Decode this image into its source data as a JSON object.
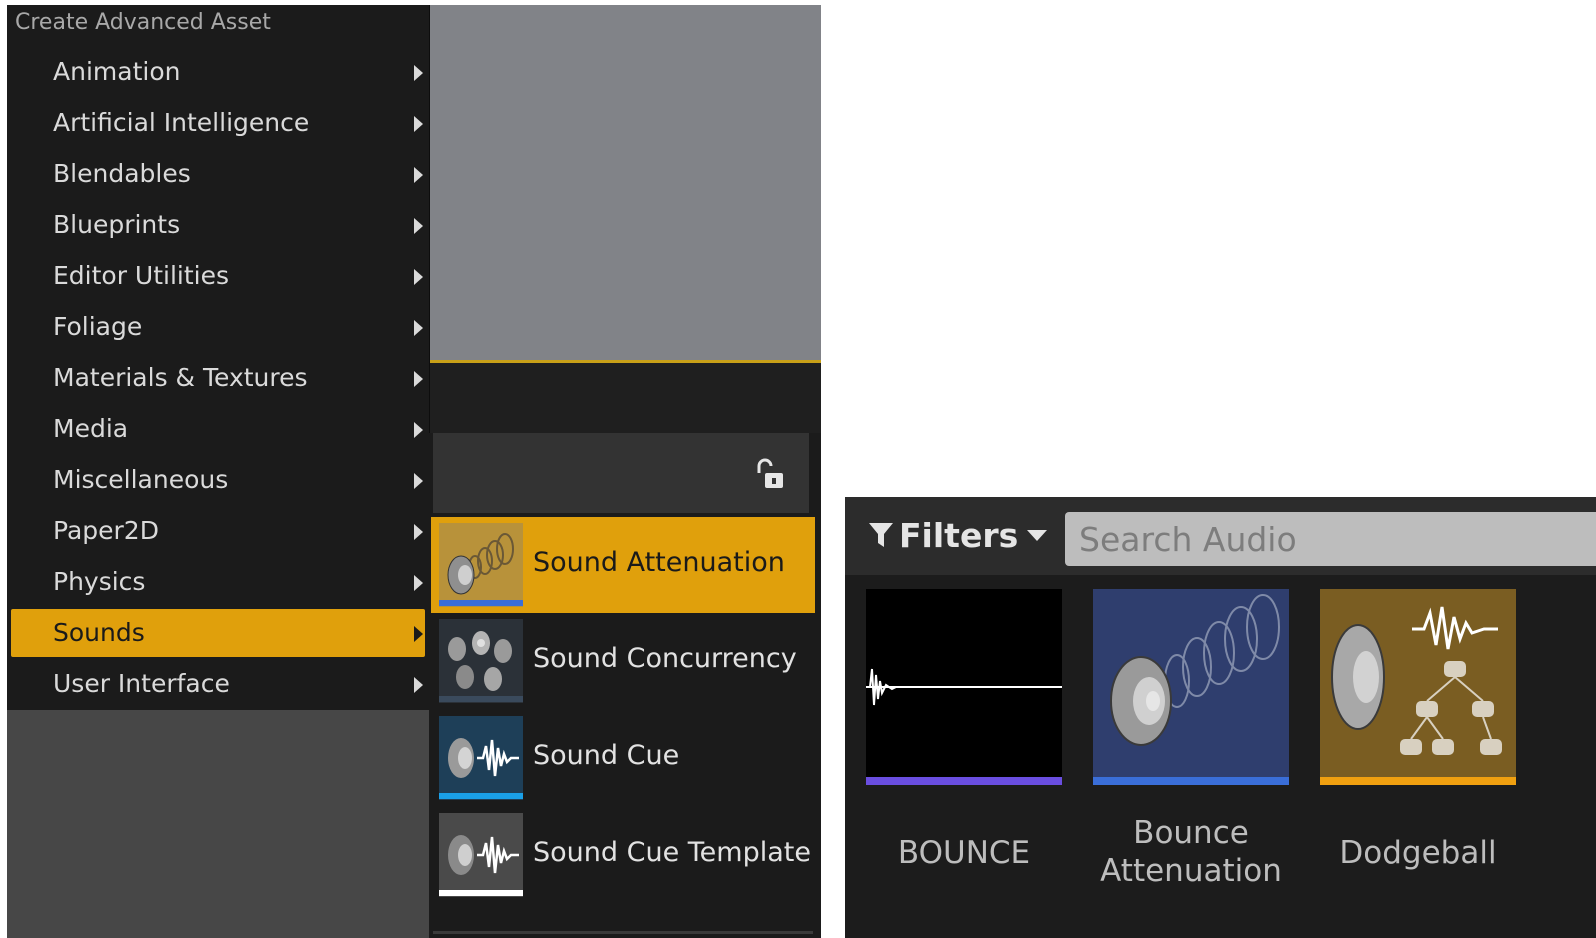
{
  "menu": {
    "header": "Create Advanced Asset",
    "items": [
      {
        "label": "Animation"
      },
      {
        "label": "Artificial Intelligence"
      },
      {
        "label": "Blendables"
      },
      {
        "label": "Blueprints"
      },
      {
        "label": "Editor Utilities"
      },
      {
        "label": "Foliage"
      },
      {
        "label": "Materials & Textures"
      },
      {
        "label": "Media"
      },
      {
        "label": "Miscellaneous"
      },
      {
        "label": "Paper2D"
      },
      {
        "label": "Physics"
      },
      {
        "label": "Sounds",
        "selected": true
      },
      {
        "label": "User Interface"
      }
    ],
    "arrow_icon": "submenu-arrow-icon"
  },
  "submenu": {
    "lock_icon": "unlock-icon",
    "items": [
      {
        "label": "Sound Attenuation",
        "icon": "sound-attenuation-icon",
        "selected": true,
        "bar_color": "#3a6ed8"
      },
      {
        "label": "Sound Concurrency",
        "icon": "sound-concurrency-icon",
        "bar_color": "#3a4a5c"
      },
      {
        "label": "Sound Cue",
        "icon": "sound-cue-icon",
        "bar_color": "#1aa0e8"
      },
      {
        "label": "Sound Cue Template",
        "icon": "sound-cue-template-icon",
        "bar_color": "#ffffff"
      }
    ]
  },
  "browser": {
    "filters_label": "Filters",
    "search_placeholder": "Search Audio",
    "assets": [
      {
        "label": "BOUNCE",
        "type": "sound-wave",
        "bar_color": "#6a4ee0"
      },
      {
        "label": "Bounce Attenuation",
        "type": "sound-attenuation",
        "bar_color": "#3a6ed8"
      },
      {
        "label": "Dodgeball",
        "type": "sound-cue",
        "bar_color": "#f0a010"
      }
    ]
  },
  "colors": {
    "highlight": "#e0a00c",
    "menu_bg": "#1b1b1b",
    "viewport_bg": "#818388"
  }
}
